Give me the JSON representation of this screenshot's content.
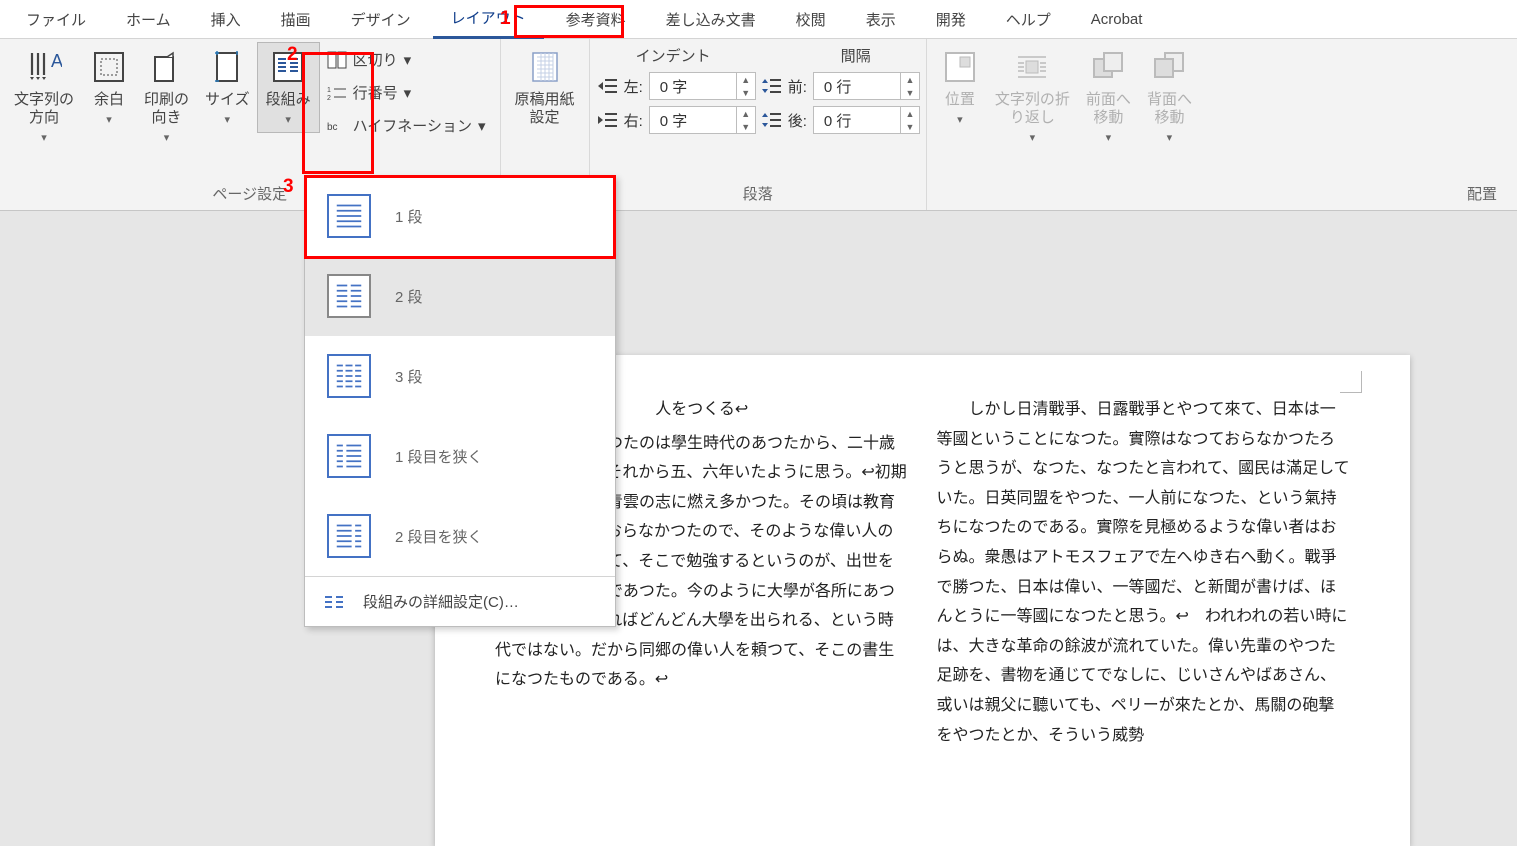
{
  "tabs": [
    "ファイル",
    "ホーム",
    "挿入",
    "描画",
    "デザイン",
    "レイアウト",
    "参考資料",
    "差し込み文書",
    "校閲",
    "表示",
    "開発",
    "ヘルプ",
    "Acrobat"
  ],
  "activeTab": 5,
  "ribbon": {
    "pageSetup": {
      "label": "ページ設定",
      "textDir": "文字列の\n方向",
      "margins": "余白",
      "orient": "印刷の\n向き",
      "size": "サイズ",
      "columns": "段組み",
      "breaks": "区切り",
      "lineNum": "行番号",
      "hyphen": "ハイフネーション"
    },
    "genko": {
      "label": "原稿用紙",
      "btn": "原稿用紙\n設定"
    },
    "paragraph": {
      "label": "段落",
      "indent": "インデント",
      "spacing": "間隔",
      "left": "左:",
      "right": "右:",
      "before": "前:",
      "after": "後:",
      "leftVal": "0 字",
      "rightVal": "0 字",
      "beforeVal": "0 行",
      "afterVal": "0 行"
    },
    "arrange": {
      "label": "配置",
      "position": "位置",
      "wrap": "文字列の折\nり返し",
      "front": "前面へ\n移動",
      "back": "背面へ\n移動"
    }
  },
  "columnsMenu": {
    "items": [
      "1 段",
      "2 段",
      "3 段",
      "1 段目を狭く",
      "2 段目を狭く"
    ],
    "more": "段組みの詳細設定(C)…"
  },
  "callouts": {
    "c1": "1",
    "c2": "2",
    "c3": "3"
  },
  "doc": {
    "title": "人をつくる↩",
    "col1": "上侯の所へいつたのは學生時代のあつたから、二十歳くらいであつたそれから五、六年いたように思う。↩初期の頃の書生は、青雲の志に燃え多かつた。その頃は教育機關がまだれておらなかつたので、そのような偉い人の所へ書生に入つて、そこで勉強するというのが、出世をする一つの道程であつた。今のように大學が各所にあつて、學資さえあればどんどん大學を出られる、という時代ではない。だから同郷の偉い人を頼つて、そこの書生になつたものである。↩",
    "col2": "　しかし日清戰爭、日露戰爭とやつて來て、日本は一等國ということになつた。實際はなつておらなかつたろうと思うが、なつた、なつたと言われて、國民は滿足していた。日英同盟をやつた、一人前になつた、という氣持ちになつたのである。實際を見極めるような偉い者はおらぬ。衆愚はアトモスフェアで左へゆき右へ動く。戰爭で勝つた、日本は偉い、一等國だ、と新聞が書けば、ほんとうに一等國になつたと思う。↩　われわれの若い時には、大きな革命の餘波が流れていた。偉い先輩のやつた足跡を、書物を通じてでなしに、じいさんやばあさん、或いは親父に聽いても、ペリーが來たとか、馬關の砲撃をやつたとか、そういう威勢"
  }
}
